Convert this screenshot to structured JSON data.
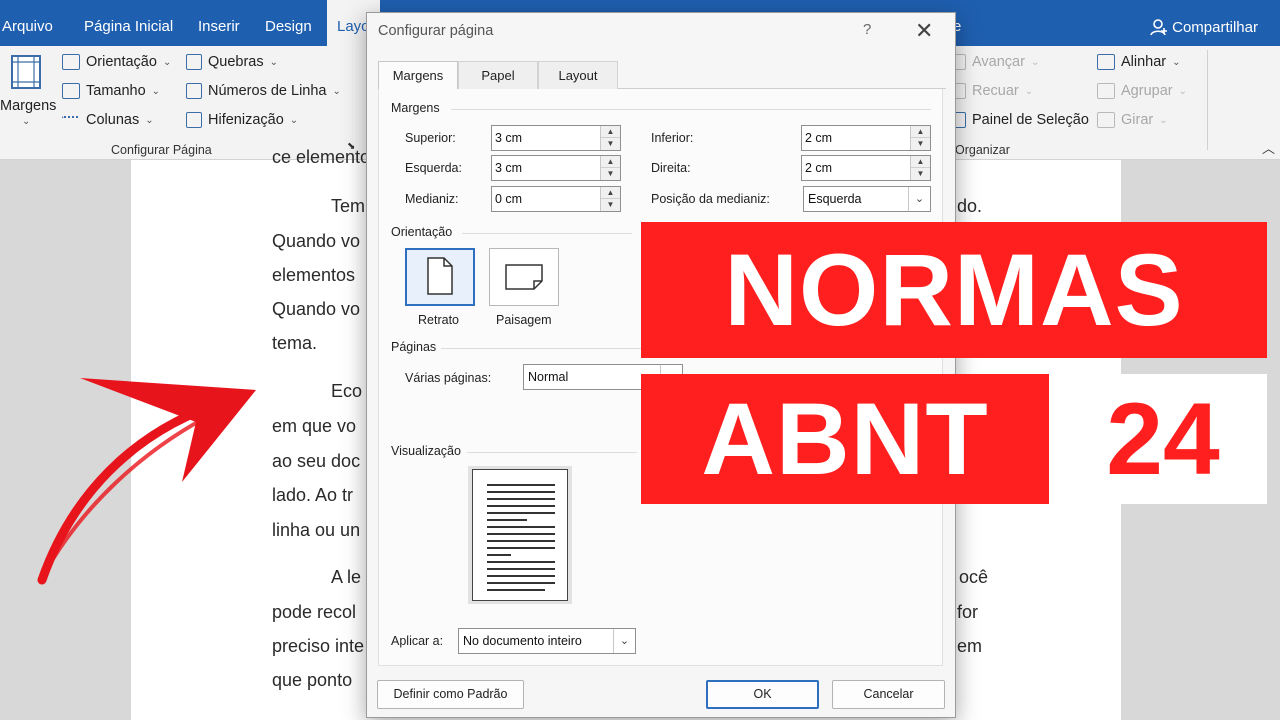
{
  "ribbon": {
    "tabs": [
      "Arquivo",
      "Página Inicial",
      "Inserir",
      "Design",
      "Layo"
    ],
    "tail_tab": "e",
    "share": "Compartilhar",
    "margins_label": "Margens",
    "orientation": "Orientação",
    "size": "Tamanho",
    "columns": "Colunas",
    "breaks": "Quebras",
    "line_numbers": "Números de Linha",
    "hyphenation": "Hifenização",
    "group_page_setup": "Configurar Página",
    "forward": "Avançar",
    "backward": "Recuar",
    "selection_pane": "Painel de Seleção",
    "align": "Alinhar",
    "group": "Agrupar",
    "rotate": "Girar",
    "group_arrange": "Organizar"
  },
  "document": {
    "lines": [
      "ce elemento",
      "Tem",
      "do.",
      "Quando vo",
      "elementos",
      "Quando vo",
      "tema.",
      "Eco",
      "em que vo",
      "ao seu doc",
      "lado. Ao tr",
      "linha ou un",
      "A le",
      "ocê",
      "pode recol",
      "for",
      "preciso inte",
      "em",
      "que ponto"
    ]
  },
  "dialog": {
    "title": "Configurar página",
    "help": "?",
    "close": "✕",
    "tabs": [
      "Margens",
      "Papel",
      "Layout"
    ],
    "margins_section": "Margens",
    "top_label": "Superior:",
    "top_value": "3 cm",
    "left_label": "Esquerda:",
    "left_value": "3 cm",
    "gutter_label": "Medianiz:",
    "gutter_value": "0 cm",
    "bottom_label": "Inferior:",
    "bottom_value": "2 cm",
    "right_label": "Direita:",
    "right_value": "2 cm",
    "gutter_pos_label": "Posição da medianiz:",
    "gutter_pos_value": "Esquerda",
    "orientation_section": "Orientação",
    "portrait": "Retrato",
    "landscape": "Paisagem",
    "pages_section": "Páginas",
    "multiple_pages_label": "Várias páginas:",
    "multiple_pages_value": "Normal",
    "preview_section": "Visualização",
    "apply_label": "Aplicar a:",
    "apply_value": "No documento inteiro",
    "default_button": "Definir como Padrão",
    "ok_button": "OK",
    "cancel_button": "Cancelar"
  },
  "banner": {
    "line1": "NORMAS",
    "line2": "ABNT",
    "number": "24",
    "color": "#ff1f1f"
  },
  "colors": {
    "ribbon_blue": "#1f5fb0",
    "selection_blue": "#2e6fbf"
  }
}
